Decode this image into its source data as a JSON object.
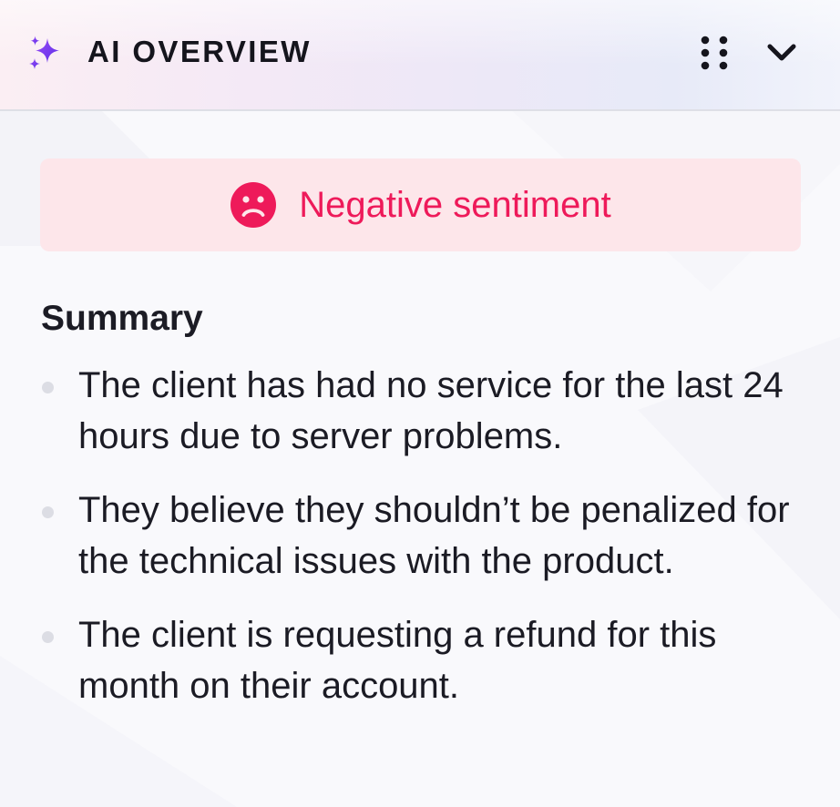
{
  "header": {
    "title": "AI OVERVIEW",
    "icon": "sparkle-icon",
    "menu_icon": "drag-handle-icon",
    "collapse_icon": "chevron-down-icon"
  },
  "sentiment": {
    "label": "Negative sentiment",
    "icon": "frown-icon",
    "text_color": "#ee1a5a",
    "background": "#fde6ea"
  },
  "summary": {
    "heading": "Summary",
    "items": [
      "The client has had no service for the last 24 hours due to server problems.",
      "They believe they shouldn’t be penalized for the technical issues with the product.",
      "The client is requesting a refund for this month on their account."
    ]
  },
  "colors": {
    "accent": "#7b3ff2",
    "negative": "#ee1a5a"
  }
}
